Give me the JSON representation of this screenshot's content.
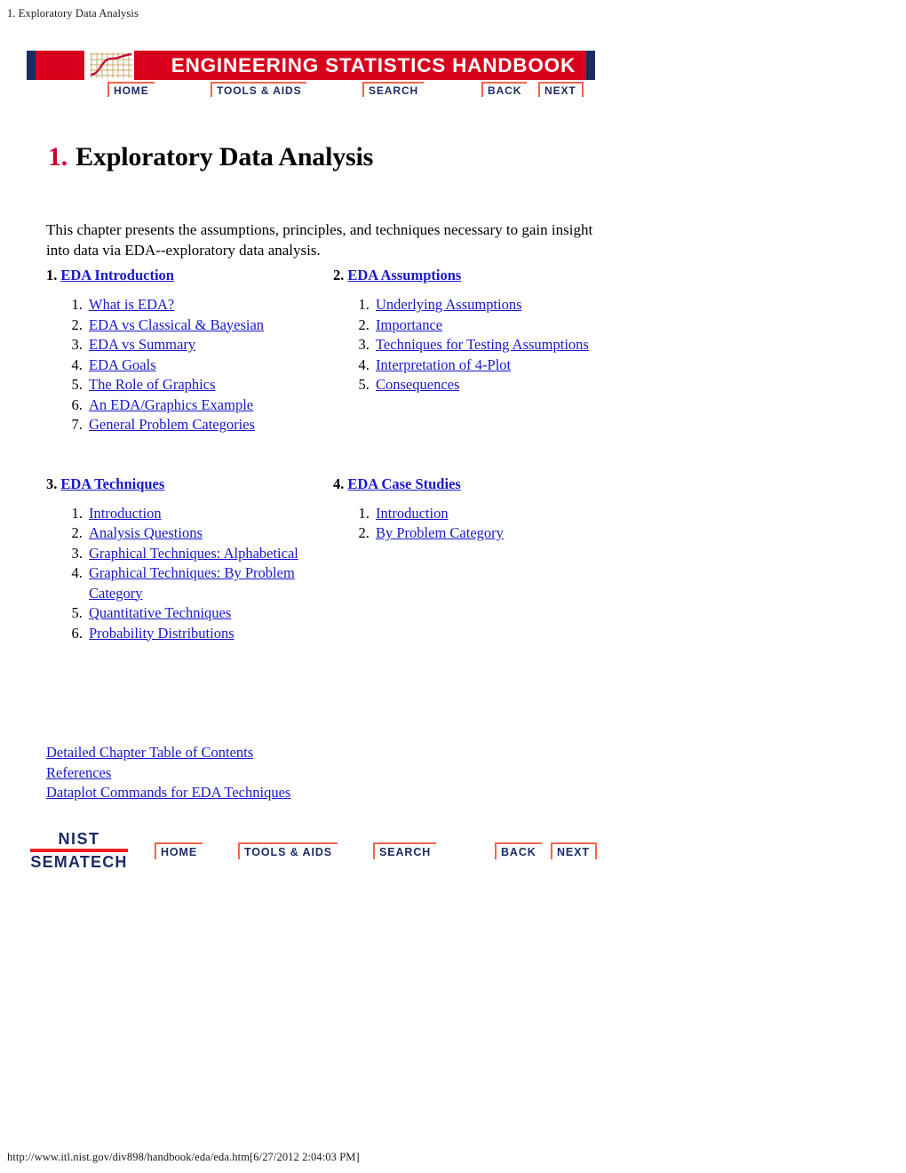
{
  "print_header": "1. Exploratory Data Analysis",
  "print_footer": "http://www.itl.nist.gov/div898/handbook/eda/eda.htm[6/27/2012 2:04:03 PM]",
  "banner": {
    "title": "ENGINEERING  STATISTICS  HANDBOOK",
    "cap_color": "#1c2b63",
    "red_color": "#d9001b",
    "grid_icon": "line-chart-grid-icon"
  },
  "top_nav": [
    {
      "label": "HOME",
      "name": "home"
    },
    {
      "label": "TOOLS & AIDS",
      "name": "tools-and-aids"
    },
    {
      "label": "SEARCH",
      "name": "search"
    },
    {
      "label": "BACK",
      "name": "back"
    },
    {
      "label": "NEXT",
      "name": "next"
    }
  ],
  "title": {
    "number": "1.",
    "text": "Exploratory Data Analysis",
    "number_color": "#cc0033"
  },
  "intro": "This chapter presents the assumptions, principles, and techniques necessary to gain insight into data via EDA--exploratory data analysis.",
  "link_color": "#1a18c9",
  "sections": [
    {
      "number": "1.",
      "title": "EDA Introduction",
      "items": [
        "What is EDA? ",
        "EDA vs Classical & Bayesian",
        "EDA vs Summary",
        "EDA Goals",
        "The Role of Graphics",
        "An EDA/Graphics Example ",
        "General Problem Categories"
      ]
    },
    {
      "number": "2.",
      "title": "EDA Assumptions ",
      "items": [
        "Underlying Assumptions",
        "Importance",
        "Techniques for Testing Assumptions",
        "Interpretation of 4-Plot",
        "Consequences"
      ]
    },
    {
      "number": "3.",
      "title": "EDA Techniques ",
      "items": [
        "Introduction",
        "Analysis Questions",
        "Graphical Techniques: Alphabetical",
        "Graphical Techniques: By Problem Category",
        "Quantitative Techniques",
        "Probability Distributions"
      ]
    },
    {
      "number": "4.",
      "title": "EDA Case Studies ",
      "items": [
        "Introduction",
        "By Problem Category"
      ]
    }
  ],
  "extra_links": [
    "Detailed Chapter Table of Contents",
    "References",
    "Dataplot Commands for EDA Techniques"
  ],
  "footer_logo": {
    "line1": "NIST",
    "line2": "SEMATECH",
    "bar_color": "#ed1c24",
    "text_color": "#1c2b63"
  },
  "footer_nav": [
    {
      "label": "HOME",
      "name": "home"
    },
    {
      "label": "TOOLS & AIDS",
      "name": "tools-and-aids"
    },
    {
      "label": "SEARCH",
      "name": "search"
    },
    {
      "label": "BACK",
      "name": "back"
    },
    {
      "label": "NEXT",
      "name": "next"
    }
  ]
}
